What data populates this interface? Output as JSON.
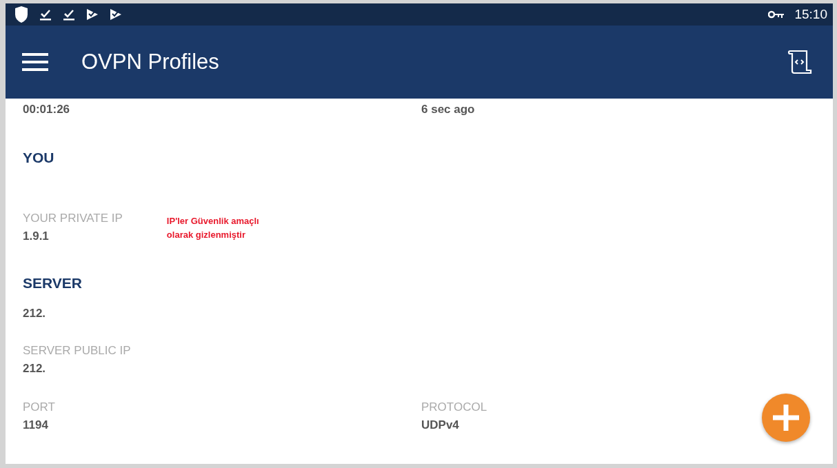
{
  "status_bar": {
    "time": "15:10"
  },
  "app_bar": {
    "title": "OVPN Profiles"
  },
  "stats_row": [
    {
      "value": "00:01:26"
    },
    {
      "value": "6 sec ago"
    }
  ],
  "you": {
    "heading": "YOU",
    "private_ip_label": "YOUR PRIVATE IP",
    "private_ip": "1.9.1",
    "note": "IP'ler Güvenlik amaçlı olarak gizlenmiştir"
  },
  "server": {
    "heading": "SERVER",
    "host": "212.",
    "public_ip_label": "SERVER PUBLIC IP",
    "public_ip": "212.",
    "fields": [
      {
        "label": "PORT",
        "value": "1194"
      },
      {
        "label": "PROTOCOL",
        "value": "UDPv4"
      }
    ]
  }
}
